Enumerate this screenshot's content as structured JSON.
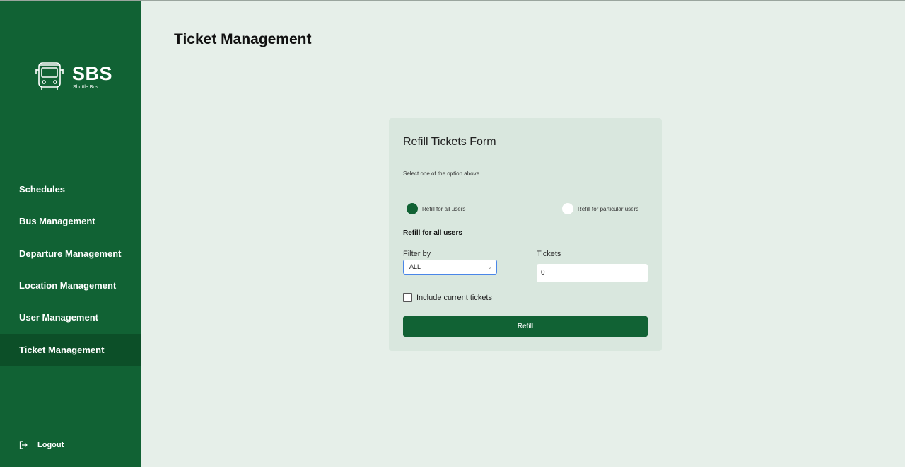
{
  "brand": {
    "name": "SBS",
    "subtitle": "Shuttle Bus"
  },
  "sidebar": {
    "items": [
      {
        "label": "Schedules"
      },
      {
        "label": "Bus Management"
      },
      {
        "label": "Departure Management"
      },
      {
        "label": "Location Management"
      },
      {
        "label": "User Management"
      },
      {
        "label": "Ticket Management",
        "active": true
      }
    ],
    "logout_label": "Logout"
  },
  "page": {
    "title": "Ticket Management"
  },
  "form": {
    "title": "Refill Tickets Form",
    "hint": "Select one of the option above",
    "options": [
      {
        "label": "Refill for all users",
        "selected": true
      },
      {
        "label": "Refill for particular users",
        "selected": false
      }
    ],
    "section_label": "Refill for all users",
    "filter_label": "Filter by",
    "filter_value": "ALL",
    "tickets_label": "Tickets",
    "tickets_value": "0",
    "include_current_label": "Include current tickets",
    "include_current_checked": false,
    "submit_label": "Refill"
  },
  "colors": {
    "primary": "#116234",
    "active_nav": "#0c4f28",
    "background": "#e6efe9",
    "card": "#d9e7de"
  }
}
